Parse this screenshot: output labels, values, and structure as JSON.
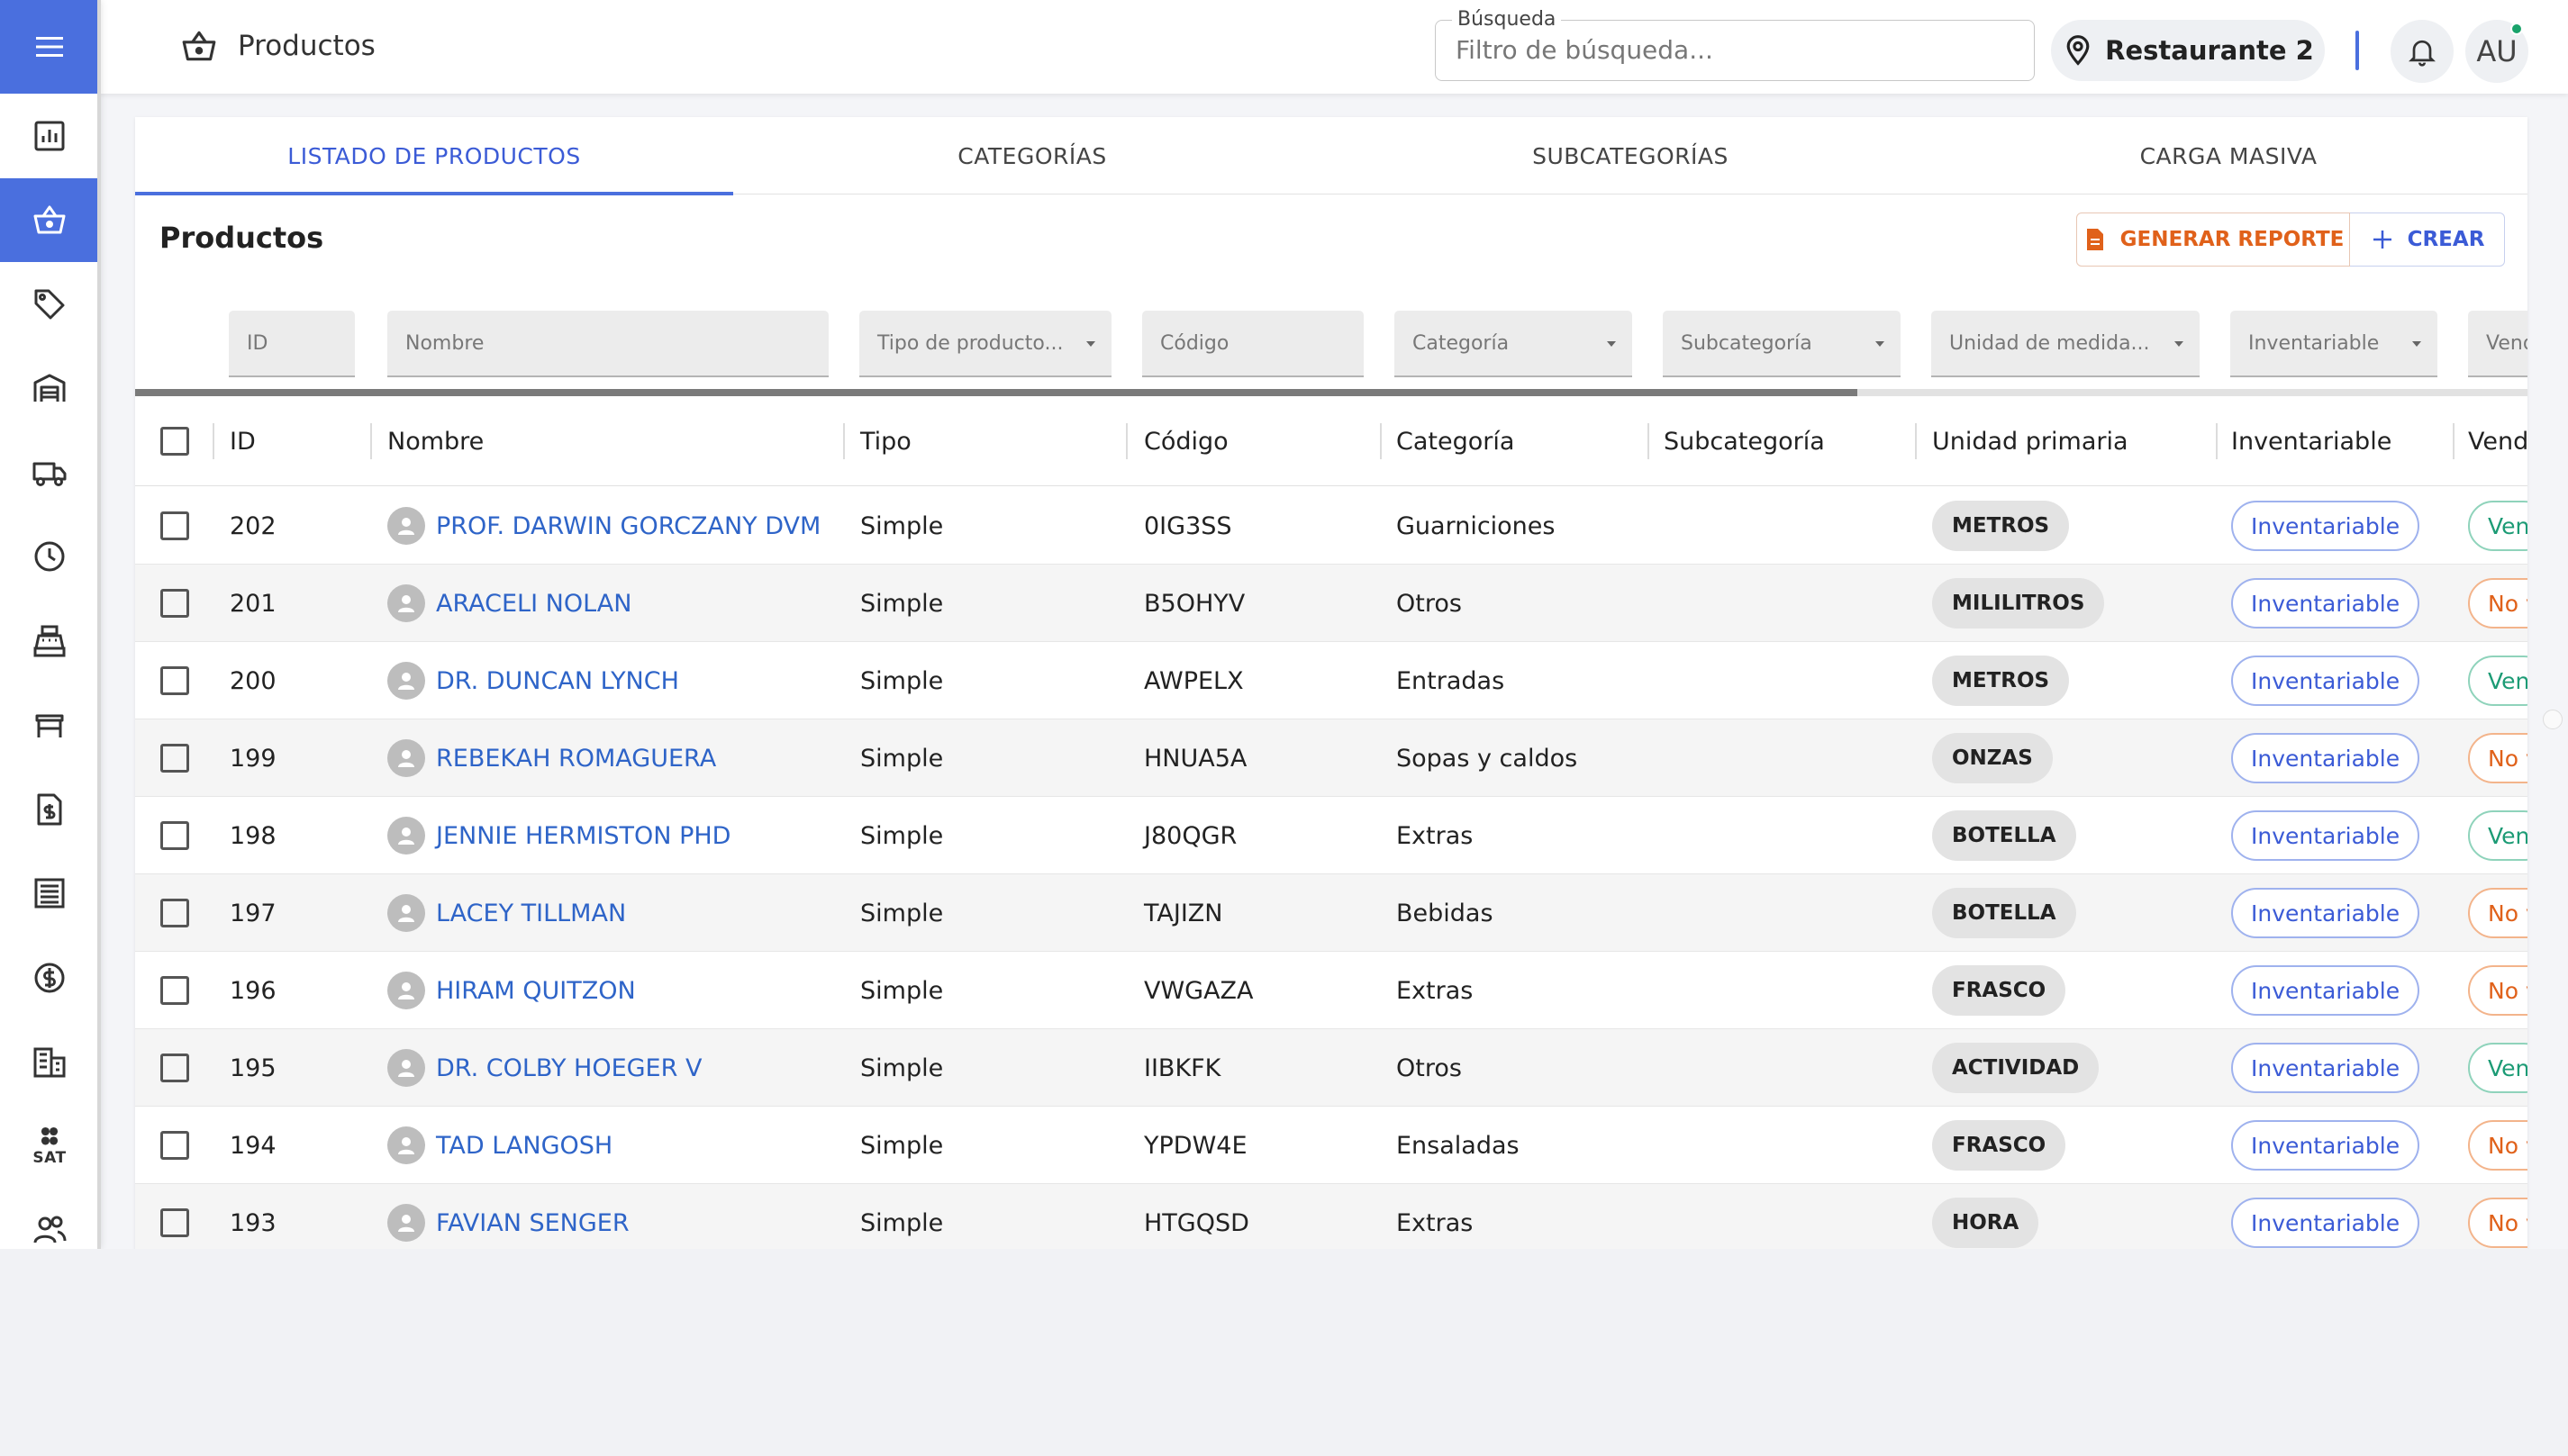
{
  "header": {
    "title": "Productos",
    "search": {
      "legend": "Búsqueda",
      "placeholder": "Filtro de búsqueda..."
    },
    "restaurant": "Restaurante 2",
    "avatar_initials": "AU"
  },
  "sidebar": {
    "items": [
      {
        "icon": "bar-chart-icon",
        "active": false
      },
      {
        "icon": "basket-icon",
        "active": true
      },
      {
        "icon": "tag-icon",
        "active": false
      },
      {
        "icon": "warehouse-icon",
        "active": false
      },
      {
        "icon": "truck-icon",
        "active": false
      },
      {
        "icon": "clock-icon",
        "active": false
      },
      {
        "icon": "cash-register-icon",
        "active": false
      },
      {
        "icon": "table-icon",
        "active": false
      },
      {
        "icon": "invoice-icon",
        "active": false
      },
      {
        "icon": "list-icon",
        "active": false
      },
      {
        "icon": "dollar-icon",
        "active": false
      },
      {
        "icon": "building-icon",
        "active": false
      },
      {
        "icon": "sat-icon",
        "active": false,
        "text": "SAT"
      },
      {
        "icon": "users-icon",
        "active": false
      }
    ]
  },
  "tabs": [
    {
      "label": "LISTADO DE PRODUCTOS",
      "active": true
    },
    {
      "label": "CATEGORÍAS",
      "active": false
    },
    {
      "label": "SUBCATEGORÍAS",
      "active": false
    },
    {
      "label": "CARGA MASIVA",
      "active": false
    }
  ],
  "section": {
    "title": "Productos",
    "report_label": "GENERAR REPORTE",
    "create_label": "CREAR"
  },
  "filters": [
    "ID",
    "Nombre",
    "Tipo de producto...",
    "Código",
    "Categoría",
    "Subcategoría",
    "Unidad de medida...",
    "Inventariable",
    "Vend"
  ],
  "loading_progress": 0.72,
  "columns": [
    "ID",
    "Nombre",
    "Tipo",
    "Código",
    "Categoría",
    "Subcategoría",
    "Unidad primaria",
    "Inventariable",
    "Vend"
  ],
  "rows": [
    {
      "id": "202",
      "nombre": "PROF. DARWIN GORCZANY DVM",
      "tipo": "Simple",
      "codigo": "0IG3SS",
      "categoria": "Guarniciones",
      "subcategoria": "",
      "unidad": "METROS",
      "inventariable": "Inventariable",
      "vendible": "Ven",
      "vend_status": "green"
    },
    {
      "id": "201",
      "nombre": "ARACELI NOLAN",
      "tipo": "Simple",
      "codigo": "B5OHYV",
      "categoria": "Otros",
      "subcategoria": "",
      "unidad": "MILILITROS",
      "inventariable": "Inventariable",
      "vendible": "No v",
      "vend_status": "orange"
    },
    {
      "id": "200",
      "nombre": "DR. DUNCAN LYNCH",
      "tipo": "Simple",
      "codigo": "AWPELX",
      "categoria": "Entradas",
      "subcategoria": "",
      "unidad": "METROS",
      "inventariable": "Inventariable",
      "vendible": "Ven",
      "vend_status": "green"
    },
    {
      "id": "199",
      "nombre": "REBEKAH ROMAGUERA",
      "tipo": "Simple",
      "codigo": "HNUA5A",
      "categoria": "Sopas y caldos",
      "subcategoria": "",
      "unidad": "ONZAS",
      "inventariable": "Inventariable",
      "vendible": "No v",
      "vend_status": "orange"
    },
    {
      "id": "198",
      "nombre": "JENNIE HERMISTON PHD",
      "tipo": "Simple",
      "codigo": "J80QGR",
      "categoria": "Extras",
      "subcategoria": "",
      "unidad": "BOTELLA",
      "inventariable": "Inventariable",
      "vendible": "Ven",
      "vend_status": "green"
    },
    {
      "id": "197",
      "nombre": "LACEY TILLMAN",
      "tipo": "Simple",
      "codigo": "TAJIZN",
      "categoria": "Bebidas",
      "subcategoria": "",
      "unidad": "BOTELLA",
      "inventariable": "Inventariable",
      "vendible": "No v",
      "vend_status": "orange"
    },
    {
      "id": "196",
      "nombre": "HIRAM QUITZON",
      "tipo": "Simple",
      "codigo": "VWGAZA",
      "categoria": "Extras",
      "subcategoria": "",
      "unidad": "FRASCO",
      "inventariable": "Inventariable",
      "vendible": "No v",
      "vend_status": "orange"
    },
    {
      "id": "195",
      "nombre": "DR. COLBY HOEGER V",
      "tipo": "Simple",
      "codigo": "IIBKFK",
      "categoria": "Otros",
      "subcategoria": "",
      "unidad": "ACTIVIDAD",
      "inventariable": "Inventariable",
      "vendible": "Ven",
      "vend_status": "green"
    },
    {
      "id": "194",
      "nombre": "TAD LANGOSH",
      "tipo": "Simple",
      "codigo": "YPDW4E",
      "categoria": "Ensaladas",
      "subcategoria": "",
      "unidad": "FRASCO",
      "inventariable": "Inventariable",
      "vendible": "No v",
      "vend_status": "orange"
    },
    {
      "id": "193",
      "nombre": "FAVIAN SENGER",
      "tipo": "Simple",
      "codigo": "HTGQSD",
      "categoria": "Extras",
      "subcategoria": "",
      "unidad": "HORA",
      "inventariable": "Inventariable",
      "vendible": "No v",
      "vend_status": "orange"
    }
  ],
  "colors": {
    "accent": "#4a6fde",
    "link": "#2e64c8",
    "report": "#e0611a",
    "green": "#1c9b75"
  }
}
